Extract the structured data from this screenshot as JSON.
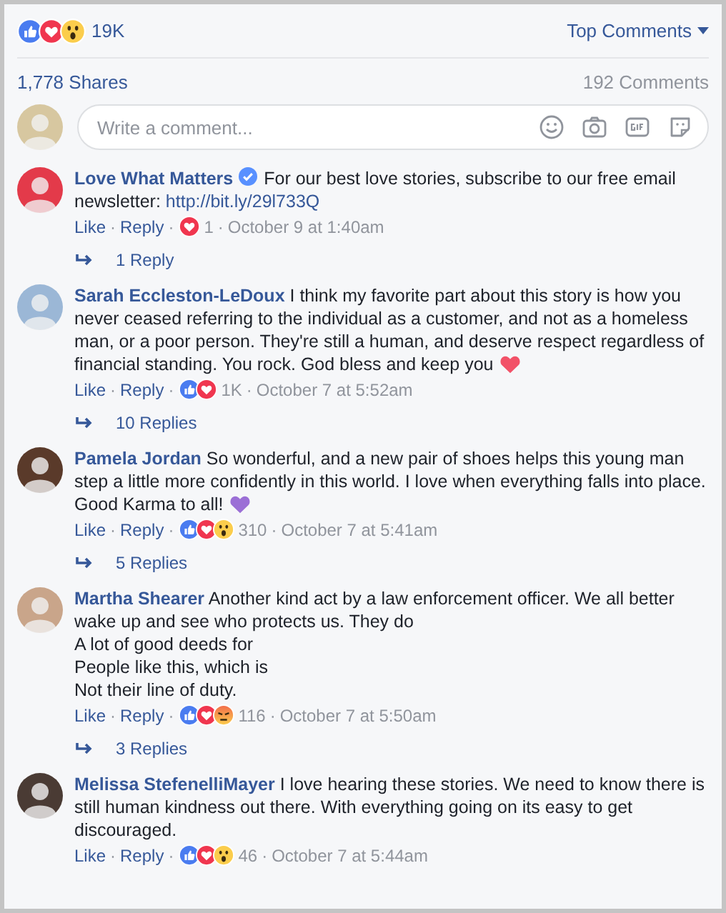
{
  "summary": {
    "reactions": [
      {
        "kind": "like"
      },
      {
        "kind": "love"
      },
      {
        "kind": "wow"
      }
    ],
    "count": "19K",
    "sort": "Top Comments"
  },
  "shares": "1,778 Shares",
  "comments_count": "192 Comments",
  "separator": "·",
  "composer": {
    "placeholder": "Write a comment..."
  },
  "comments": [
    {
      "author": "Love What Matters",
      "verified": true,
      "text": "For our best love stories, subscribe to our free email newsletter: ",
      "link": "http://bit.ly/29l733Q",
      "like": "Like",
      "reply": "Reply",
      "reactions": [
        {
          "kind": "love"
        }
      ],
      "reaction_count": "1",
      "time": "October 9 at 1:40am",
      "replies": "1 Reply"
    },
    {
      "author": "Sarah Eccleston-LeDoux",
      "verified": false,
      "text": "I think my favorite part about this story is how you never ceased referring to the individual as a customer, and not as a homeless man, or a poor person. They're still a human, and deserve respect regardless of financial standing. You rock. God bless and keep you",
      "end_icon": {
        "kind": "heart",
        "color": "#f25268"
      },
      "like": "Like",
      "reply": "Reply",
      "reactions": [
        {
          "kind": "like"
        },
        {
          "kind": "love"
        }
      ],
      "reaction_count": "1K",
      "time": "October 7 at 5:52am",
      "replies": "10 Replies"
    },
    {
      "author": "Pamela Jordan",
      "verified": false,
      "text": "So wonderful, and a new pair of shoes helps this young man step a little more confidently in this world. I love when everything falls into place. Good Karma to all!",
      "end_icon": {
        "kind": "heart",
        "color": "#9b6fd6"
      },
      "like": "Like",
      "reply": "Reply",
      "reactions": [
        {
          "kind": "like"
        },
        {
          "kind": "love"
        },
        {
          "kind": "wow"
        }
      ],
      "reaction_count": "310",
      "time": "October 7 at 5:41am",
      "replies": "5 Replies"
    },
    {
      "author": "Martha Shearer",
      "verified": false,
      "text": "Another kind act by a law enforcement officer. We all better wake up and see who protects us. They do\nA lot of good deeds for\nPeople like this, which is\nNot their line of duty.",
      "like": "Like",
      "reply": "Reply",
      "reactions": [
        {
          "kind": "like"
        },
        {
          "kind": "love"
        },
        {
          "kind": "angry"
        }
      ],
      "reaction_count": "116",
      "time": "October 7 at 5:50am",
      "replies": "3 Replies"
    },
    {
      "author": "Melissa StefenelliMayer",
      "verified": false,
      "text": "I love hearing these stories. We need to know there is still human kindness out there. With everything going on its easy to get discouraged.",
      "like": "Like",
      "reply": "Reply",
      "reactions": [
        {
          "kind": "like"
        },
        {
          "kind": "love"
        },
        {
          "kind": "wow"
        }
      ],
      "reaction_count": "46",
      "time": "October 7 at 5:44am"
    }
  ]
}
